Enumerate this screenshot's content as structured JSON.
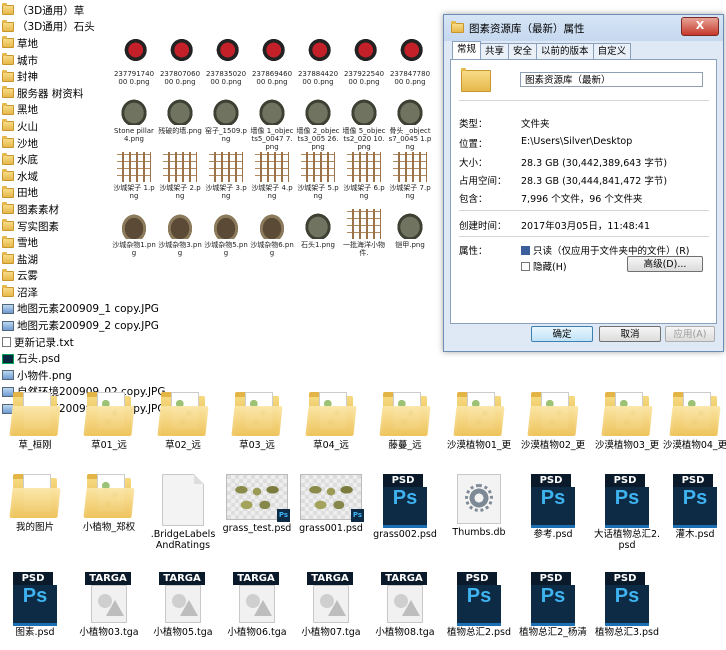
{
  "list": [
    {
      "icon": "folder",
      "label": "（3D通用）草"
    },
    {
      "icon": "folder",
      "label": "（3D通用）石头"
    },
    {
      "icon": "folder",
      "label": "草地"
    },
    {
      "icon": "folder",
      "label": "城市"
    },
    {
      "icon": "folder",
      "label": "封神"
    },
    {
      "icon": "folder",
      "label": "服务器 树资料"
    },
    {
      "icon": "folder",
      "label": "黑地"
    },
    {
      "icon": "folder",
      "label": "火山"
    },
    {
      "icon": "folder",
      "label": "沙地"
    },
    {
      "icon": "folder",
      "label": "水底"
    },
    {
      "icon": "folder",
      "label": "水域"
    },
    {
      "icon": "folder",
      "label": "田地"
    },
    {
      "icon": "folder",
      "label": "图素素材"
    },
    {
      "icon": "folder",
      "label": "写实图素"
    },
    {
      "icon": "folder",
      "label": "雪地"
    },
    {
      "icon": "folder",
      "label": "盐湖"
    },
    {
      "icon": "folder",
      "label": "云雾"
    },
    {
      "icon": "folder",
      "label": "沼泽"
    },
    {
      "icon": "image",
      "label": "地图元素200909_1 copy.JPG"
    },
    {
      "icon": "image",
      "label": "地图元素200909_2 copy.JPG"
    },
    {
      "icon": "text",
      "label": "更新记录.txt"
    },
    {
      "icon": "psd",
      "label": "石头.psd"
    },
    {
      "icon": "image",
      "label": "小物件.png"
    },
    {
      "icon": "image",
      "label": "自然环境200909_02 copy.JPG"
    },
    {
      "icon": "image",
      "label": "自然环境200909_03 copy.JPG"
    }
  ],
  "thumbs": [
    {
      "kind": "red",
      "label": "23779174000 0.png"
    },
    {
      "kind": "red",
      "label": "23780706000 0.png"
    },
    {
      "kind": "red",
      "label": "23783502000 0.png"
    },
    {
      "kind": "red",
      "label": "23786946000 0.png"
    },
    {
      "kind": "red",
      "label": "23788442000 0.png"
    },
    {
      "kind": "red",
      "label": "23792254000 0.png"
    },
    {
      "kind": "red",
      "label": "23784778000 0.png"
    },
    {
      "kind": "stone",
      "label": "Stone pillar4.png"
    },
    {
      "kind": "stone",
      "label": "残破的墙.png"
    },
    {
      "kind": "stone",
      "label": "窑子_1509.png"
    },
    {
      "kind": "stone",
      "label": "墙像 1_objects5_0047 7.png"
    },
    {
      "kind": "stone",
      "label": "墙像 2_objects3_005 26.png"
    },
    {
      "kind": "stone",
      "label": "墙像 5_objects2_020 10.png"
    },
    {
      "kind": "stone",
      "label": "骨头 _objects7_0045 1.png"
    },
    {
      "kind": "frame",
      "label": "沙城架子 1.png"
    },
    {
      "kind": "frame",
      "label": "沙城架子 2.png"
    },
    {
      "kind": "frame",
      "label": "沙城架子 3.png"
    },
    {
      "kind": "frame",
      "label": "沙城架子 4.png"
    },
    {
      "kind": "frame",
      "label": "沙城架子 5.png"
    },
    {
      "kind": "frame",
      "label": "沙城架子 6.png"
    },
    {
      "kind": "frame",
      "label": "沙城架子 7.png"
    },
    {
      "kind": "debris",
      "label": "沙城杂物1.png"
    },
    {
      "kind": "debris",
      "label": "沙城杂物3.png"
    },
    {
      "kind": "debris",
      "label": "沙城杂物5.png"
    },
    {
      "kind": "debris",
      "label": "沙城杂物6.png"
    },
    {
      "kind": "stone",
      "label": "石头1.png"
    },
    {
      "kind": "frame",
      "label": "一批海洋小物件."
    },
    {
      "kind": "stone",
      "label": "铠甲.png"
    }
  ],
  "dialog": {
    "title": "图素资源库（最新）属性",
    "close": "X",
    "tabs": [
      "常规",
      "共享",
      "安全",
      "以前的版本",
      "自定义"
    ],
    "name": "图素资源库（最新）",
    "rows": [
      {
        "k": "类型：",
        "v": "文件夹"
      },
      {
        "k": "位置：",
        "v": "E:\\Users\\Silver\\Desktop"
      },
      {
        "k": "大小：",
        "v": "28.3 GB (30,442,389,643 字节)"
      },
      {
        "k": "占用空间：",
        "v": "28.3 GB (30,444,841,472 字节)"
      },
      {
        "k": "包含：",
        "v": "7,996 个文件，96 个文件夹"
      },
      {
        "k": "创建时间：",
        "v": "2017年03月05日，11:48:41"
      }
    ],
    "attr_label": "属性：",
    "readonly": "只读（仅应用于文件夹中的文件）(R)",
    "hidden": "隐藏(H)",
    "advanced": "高级(D)...",
    "ok": "确定",
    "cancel": "取消",
    "apply": "应用(A)"
  },
  "grid_row1": [
    {
      "label": "草_桓刚"
    },
    {
      "label": "草01_远"
    },
    {
      "label": "草02_远"
    },
    {
      "label": "草03_远"
    },
    {
      "label": "草04_远"
    },
    {
      "label": "藤蔓_远"
    },
    {
      "label": "沙漠植物01_更"
    },
    {
      "label": "沙漠植物02_更"
    },
    {
      "label": "沙漠植物03_更"
    },
    {
      "label": "沙漠植物04_更"
    }
  ],
  "grid_row2": [
    {
      "type": "folder",
      "label": "我的图片"
    },
    {
      "type": "folder",
      "label": "小植物_郑权"
    },
    {
      "type": "blank",
      "label": ".BridgeLabelsAndRatings"
    },
    {
      "type": "gthumb",
      "label": "grass_test.psd"
    },
    {
      "type": "gthumb",
      "label": "grass001.psd"
    },
    {
      "type": "psd",
      "label": "grass002.psd"
    },
    {
      "type": "db",
      "label": "Thumbs.db"
    },
    {
      "type": "psd",
      "label": "参考.psd"
    },
    {
      "type": "psd",
      "label": "大话植物总汇2.psd"
    },
    {
      "type": "psd",
      "label": "灌木.psd"
    }
  ],
  "grid_row3": [
    {
      "type": "psd",
      "label": "图素.psd"
    },
    {
      "type": "tga",
      "label": "小植物03.tga"
    },
    {
      "type": "tga",
      "label": "小植物05.tga"
    },
    {
      "type": "tga",
      "label": "小植物06.tga"
    },
    {
      "type": "tga",
      "label": "小植物07.tga"
    },
    {
      "type": "tga",
      "label": "小植物08.tga"
    },
    {
      "type": "psd",
      "label": "植物总汇2.psd"
    },
    {
      "type": "psd",
      "label": "植物总汇2_杨清"
    },
    {
      "type": "psd",
      "label": "植物总汇3.psd"
    }
  ],
  "badges": {
    "psd": "PSD",
    "ps": "Ps",
    "tga": "TARGA"
  }
}
